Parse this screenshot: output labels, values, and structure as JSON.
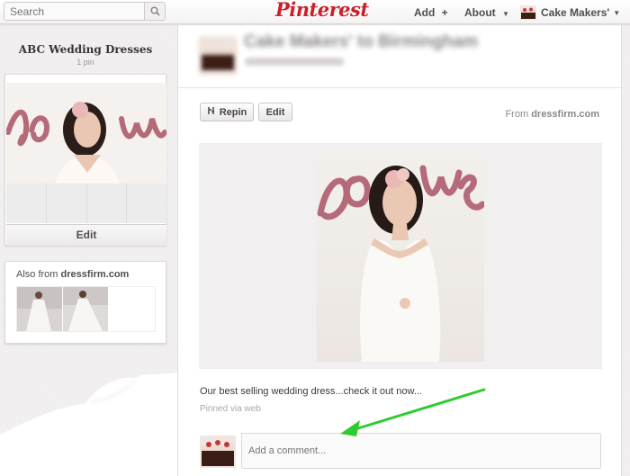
{
  "header": {
    "search_placeholder": "Search",
    "logo": "Pinterest",
    "add_label": "Add",
    "add_icon": "+",
    "about_label": "About",
    "user_label": "Cake Makers'",
    "caret": "▼"
  },
  "board": {
    "title": "ABC Wedding Dresses",
    "count": "1 pin",
    "edit_label": "Edit",
    "cover_script": "Love"
  },
  "also_from": {
    "prefix": "Also from",
    "site": "dressfirm.com"
  },
  "pin": {
    "blurred_title": "Cake Makers' to Birmingham",
    "repin_label": "Repin",
    "edit_label": "Edit",
    "from_prefix": "From",
    "from_site": "dressfirm.com",
    "description": "Our best selling wedding dress...check it out now...",
    "pinned_via": "Pinned via web",
    "comment_placeholder": "Add a comment...",
    "image_script": "Love"
  },
  "colors": {
    "brand": "#cb2027",
    "annotation_arrow": "#2ecc2e",
    "script_love": "#b56a78"
  },
  "icons": [
    "search-icon",
    "plus-icon",
    "chevron-down-icon",
    "repin-icon",
    "annotation-arrow"
  ]
}
